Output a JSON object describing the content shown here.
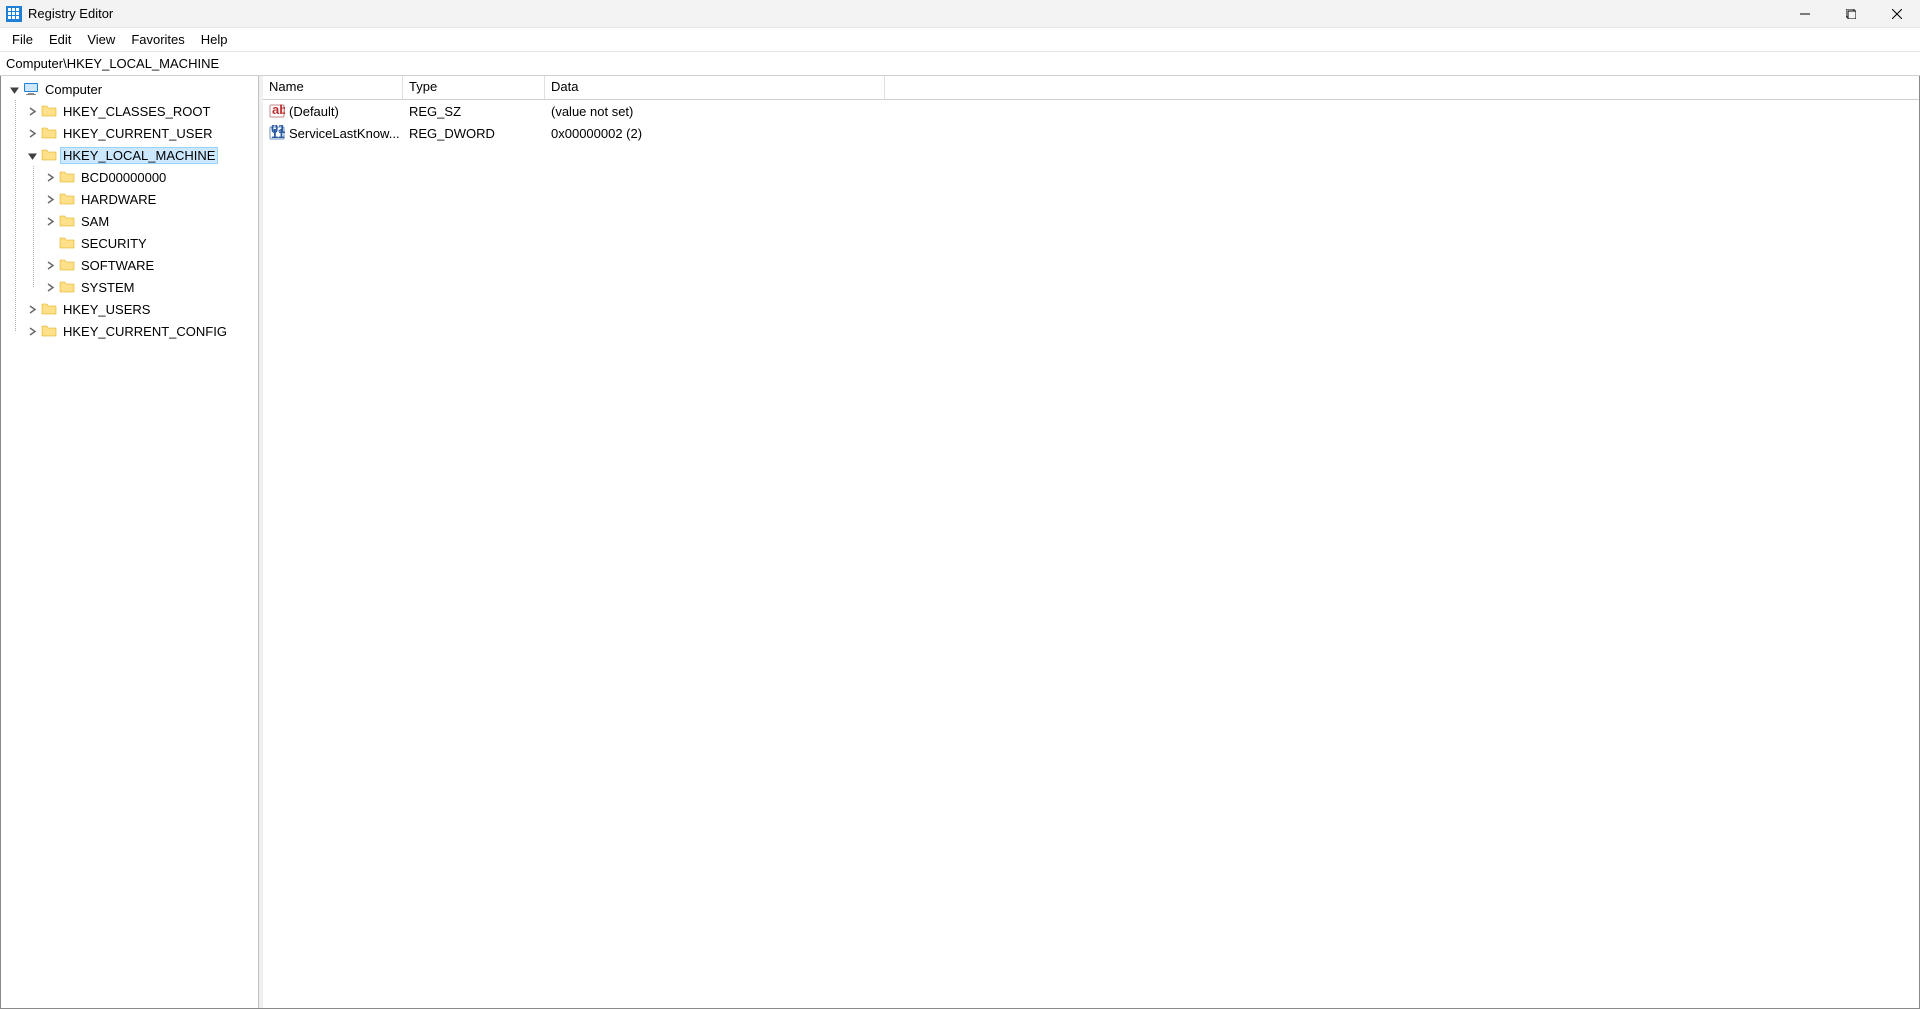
{
  "window": {
    "title": "Registry Editor"
  },
  "menu": [
    "File",
    "Edit",
    "View",
    "Favorites",
    "Help"
  ],
  "address": "Computer\\HKEY_LOCAL_MACHINE",
  "tree": {
    "root": "Computer",
    "hives": [
      {
        "name": "HKEY_CLASSES_ROOT",
        "expanded": false,
        "children": true
      },
      {
        "name": "HKEY_CURRENT_USER",
        "expanded": false,
        "children": true
      },
      {
        "name": "HKEY_LOCAL_MACHINE",
        "expanded": true,
        "children": true,
        "selected": true,
        "keys": [
          {
            "name": "BCD00000000",
            "children": true
          },
          {
            "name": "HARDWARE",
            "children": true
          },
          {
            "name": "SAM",
            "children": true
          },
          {
            "name": "SECURITY",
            "children": false
          },
          {
            "name": "SOFTWARE",
            "children": true
          },
          {
            "name": "SYSTEM",
            "children": true
          }
        ]
      },
      {
        "name": "HKEY_USERS",
        "expanded": false,
        "children": true
      },
      {
        "name": "HKEY_CURRENT_CONFIG",
        "expanded": false,
        "children": true
      }
    ]
  },
  "list": {
    "headers": {
      "name": "Name",
      "type": "Type",
      "data": "Data"
    },
    "rows": [
      {
        "icon": "string",
        "name": "(Default)",
        "type": "REG_SZ",
        "data": "(value not set)"
      },
      {
        "icon": "binary",
        "name": "ServiceLastKnow...",
        "type": "REG_DWORD",
        "data": "0x00000002 (2)"
      }
    ]
  }
}
